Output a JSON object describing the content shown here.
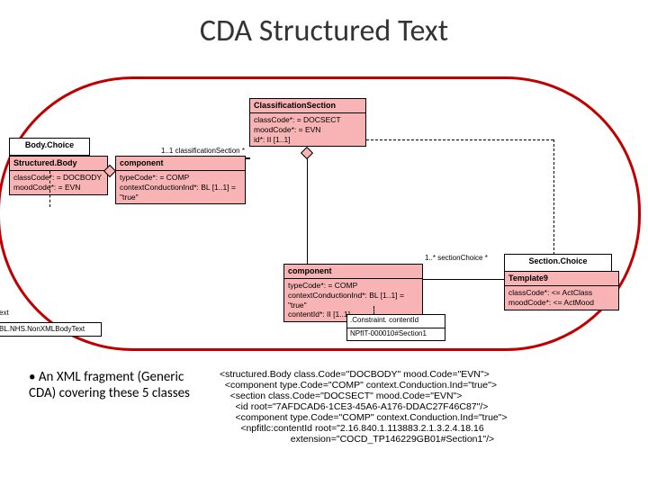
{
  "title": "CDA Structured Text",
  "bodyChoice": {
    "name": "Body.Choice"
  },
  "structuredBody": {
    "name": "Structured.Body",
    "lines": [
      "classCode*: = DOCBODY",
      "moodCode*: = EVN"
    ]
  },
  "component1": {
    "name": "component",
    "lines": [
      "typeCode*: = COMP",
      "contextConductionInd*: BL [1..1] = \"true\""
    ]
  },
  "classificationSection": {
    "name": "ClassificationSection",
    "lines": [
      "classCode*: = DOCSECT",
      "moodCode*: = EVN",
      "id*: II [1..1]"
    ]
  },
  "component2": {
    "name": "component",
    "lines": [
      "typeCode*: = COMP",
      "contextConductionInd*: BL [1..1] = \"true\"",
      "contentId*: II [1..1]"
    ]
  },
  "sectionChoice": {
    "name": "Section.Choice"
  },
  "template9": {
    "name": "Template9",
    "lines": [
      "classCode*: <= ActClass",
      "moodCode*: <= ActMood"
    ]
  },
  "sideText": "Text",
  "sideBox": "BL.NHS.NonXMLBodyText",
  "constraint1": ".Constraint. contentId",
  "constraint2": "NPfIT-000010#Section1",
  "assocLabels": {
    "classSec": "1..1 classificationSection *",
    "secChoice": "1..* sectionChoice *"
  },
  "bullet": "• An XML fragment (Generic CDA) covering these 5 classes",
  "xml": {
    "l1a": "<structured.Body ",
    "l1b": "class.Code",
    "l1c": "=\"DOCBODY\" ",
    "l1d": "mood.Code",
    "l1e": "=\"EVN\">",
    "l2a": "  <component ",
    "l2b": "type.Code",
    "l2c": "=\"COMP\" ",
    "l2d": "context.Conduction.Ind",
    "l2e": "=\"true\">",
    "l3a": "    <section ",
    "l3b": "class.Code",
    "l3c": "=\"DOCSECT\" ",
    "l3d": "mood.Code",
    "l3e": "=\"EVN\">",
    "l4a": "      <id ",
    "l4b": "root",
    "l4c": "=\"7AFDCAD6-1CE3-45A6-A176-DDAC27F46C87\"/>",
    "l5a": "      <component ",
    "l5b": "type.Code",
    "l5c": "=\"COMP\" ",
    "l5d": "context.Conduction.Ind",
    "l5e": "=\"true\">",
    "l6a": "        <npfitlc:contentId ",
    "l6b": "root",
    "l6c": "=\"2.16.840.1.113883.2.1.3.2.4.18.16",
    "l7a": "                           ",
    "l7b": "extension",
    "l7c": "=\"COCD_TP146229GB01#Section1\"/>"
  }
}
